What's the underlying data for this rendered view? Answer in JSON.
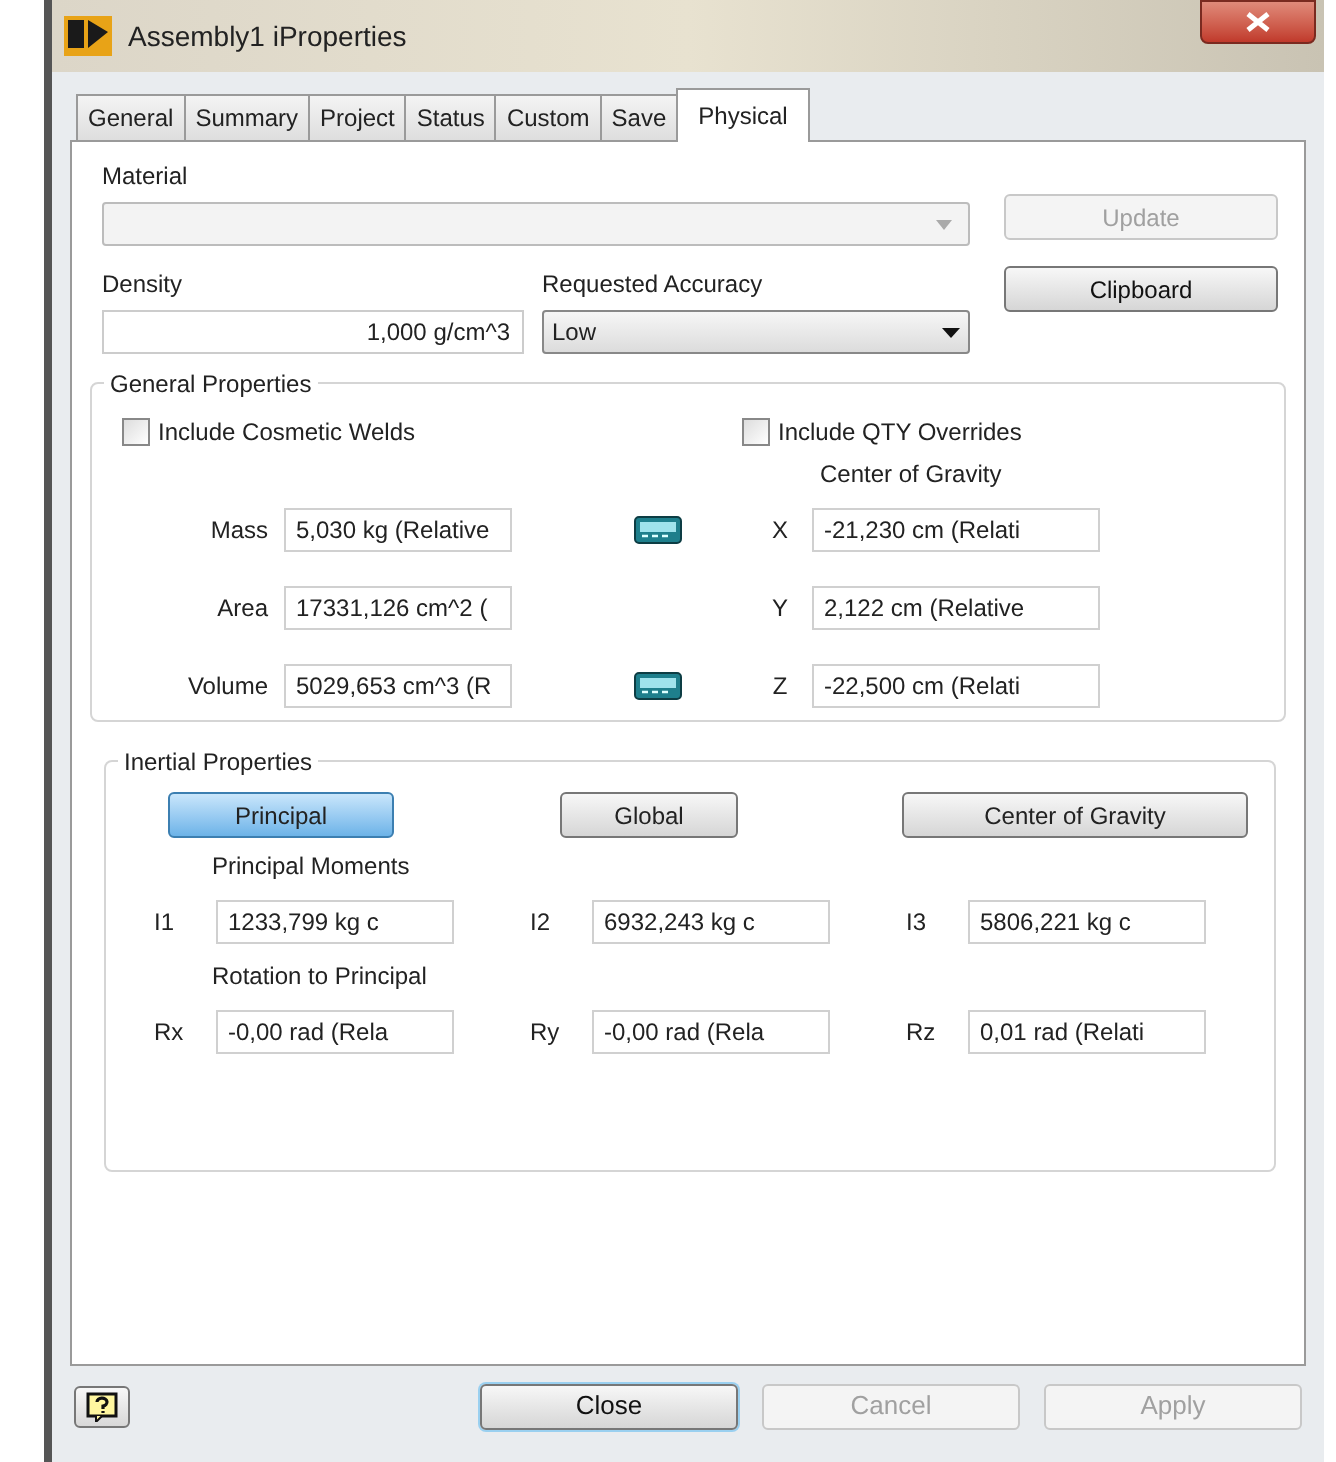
{
  "window": {
    "title": "Assembly1 iProperties"
  },
  "tabs": [
    {
      "label": "General",
      "selected": false
    },
    {
      "label": "Summary",
      "selected": false
    },
    {
      "label": "Project",
      "selected": false
    },
    {
      "label": "Status",
      "selected": false
    },
    {
      "label": "Custom",
      "selected": false
    },
    {
      "label": "Save",
      "selected": false
    },
    {
      "label": "Physical",
      "selected": true
    }
  ],
  "material": {
    "label": "Material",
    "disabled": true
  },
  "update_button": {
    "label": "Update",
    "disabled": true
  },
  "density": {
    "label": "Density",
    "value": "1,000 g/cm^3"
  },
  "requested_accuracy": {
    "label": "Requested Accuracy",
    "value": "Low"
  },
  "clipboard_button": {
    "label": "Clipboard",
    "disabled": false
  },
  "general_properties": {
    "title": "General Properties",
    "checkboxes": [
      {
        "label": "Include Cosmetic Welds",
        "checked": false
      },
      {
        "label": "Include QTY Overrides",
        "checked": false
      }
    ],
    "center_of_gravity_label": "Center of Gravity",
    "rows": [
      {
        "label": "Mass",
        "value": "5,030 kg (Relative",
        "calculator": true,
        "axis": "X",
        "axis_value": "-21,230 cm (Relati"
      },
      {
        "label": "Area",
        "value": "17331,126 cm^2 (",
        "calculator": false,
        "axis": "Y",
        "axis_value": "2,122 cm (Relative"
      },
      {
        "label": "Volume",
        "value": "5029,653 cm^3 (R",
        "calculator": true,
        "axis": "Z",
        "axis_value": "-22,500 cm (Relati"
      }
    ]
  },
  "inertial_properties": {
    "title": "Inertial Properties",
    "buttons": [
      {
        "label": "Principal",
        "selected": true
      },
      {
        "label": "Global",
        "selected": false
      },
      {
        "label": "Center of Gravity",
        "selected": false
      }
    ],
    "principal_moments_label": "Principal Moments",
    "moments": [
      {
        "label": "I1",
        "value": "1233,799 kg c"
      },
      {
        "label": "I2",
        "value": "6932,243 kg c"
      },
      {
        "label": "I3",
        "value": "5806,221 kg c"
      }
    ],
    "rotation_label": "Rotation to Principal",
    "rotations": [
      {
        "label": "Rx",
        "value": "-0,00 rad (Rela"
      },
      {
        "label": "Ry",
        "value": "-0,00 rad (Rela"
      },
      {
        "label": "Rz",
        "value": "0,01 rad (Relati"
      }
    ]
  },
  "footer_buttons": [
    {
      "label": "Close",
      "disabled": false,
      "default": true
    },
    {
      "label": "Cancel",
      "disabled": true,
      "default": false
    },
    {
      "label": "Apply",
      "disabled": true,
      "default": false
    }
  ]
}
